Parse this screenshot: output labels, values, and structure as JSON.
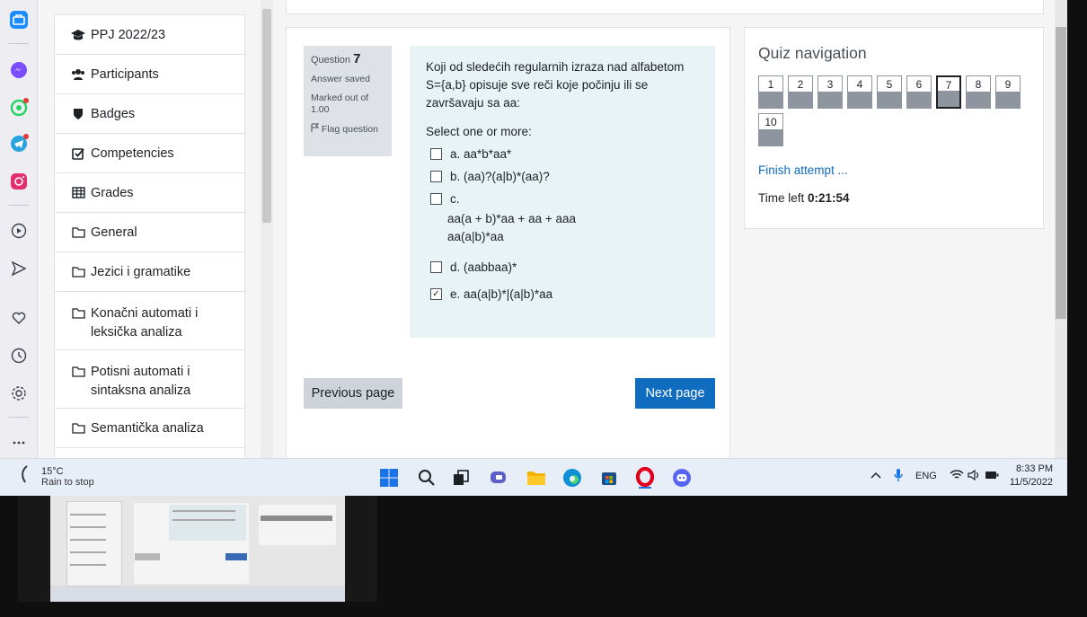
{
  "sidebar": {
    "items": [
      {
        "label": "PPJ 2022/23",
        "icon": "graduation-cap-icon"
      },
      {
        "label": "Participants",
        "icon": "users-icon"
      },
      {
        "label": "Badges",
        "icon": "shield-icon"
      },
      {
        "label": "Competencies",
        "icon": "checkbox-icon"
      },
      {
        "label": "Grades",
        "icon": "table-icon"
      },
      {
        "label": "General",
        "icon": "folder-icon"
      },
      {
        "label": "Jezici i gramatike",
        "icon": "folder-icon"
      },
      {
        "label": "Konačni automati i leksička analiza",
        "icon": "folder-icon"
      },
      {
        "label": "Potisni automati i sintaksna analiza",
        "icon": "folder-icon"
      },
      {
        "label": "Semantička analiza",
        "icon": "folder-icon"
      }
    ]
  },
  "question": {
    "label": "Question",
    "number": "7",
    "status": "Answer saved",
    "marked": "Marked out of 1.00",
    "flag": "Flag question",
    "prompt": "Koji od sledećih regularnih izraza nad alfabetom S={a,b} opisuje sve reči koje počinju ili se završavaju sa aa:",
    "select_label": "Select one or more:",
    "answers": [
      {
        "label": "a. aa*b*aa*",
        "checked": false
      },
      {
        "label": "b. (aa)?(a|b)*(aa)?",
        "checked": false
      },
      {
        "label": "c.",
        "line1": "aa(a + b)*aa + aa + aaa",
        "line2": "aa(a|b)*aa",
        "checked": false
      },
      {
        "label": "d. (aabbaa)*",
        "checked": false
      },
      {
        "label": "e. aa(a|b)*|(a|b)*aa",
        "checked": true
      }
    ],
    "check_mark": "✓",
    "prev_label": "Previous page",
    "next_label": "Next page"
  },
  "quiz_nav": {
    "title": "Quiz navigation",
    "buttons": [
      "1",
      "2",
      "3",
      "4",
      "5",
      "6",
      "7",
      "8",
      "9",
      "10"
    ],
    "current": "7",
    "finish": "Finish attempt ...",
    "time_label": "Time left",
    "time_value": "0:21:54"
  },
  "taskbar": {
    "temperature": "15°C",
    "weather": "Rain to stop",
    "language": "ENG",
    "time": "8:33 PM",
    "date": "11/5/2022"
  },
  "colors": {
    "accent": "#0f6cbf",
    "question_bg": "#e7f3f5",
    "info_bg": "#dee2e6",
    "opera_red": "#e0001b"
  }
}
